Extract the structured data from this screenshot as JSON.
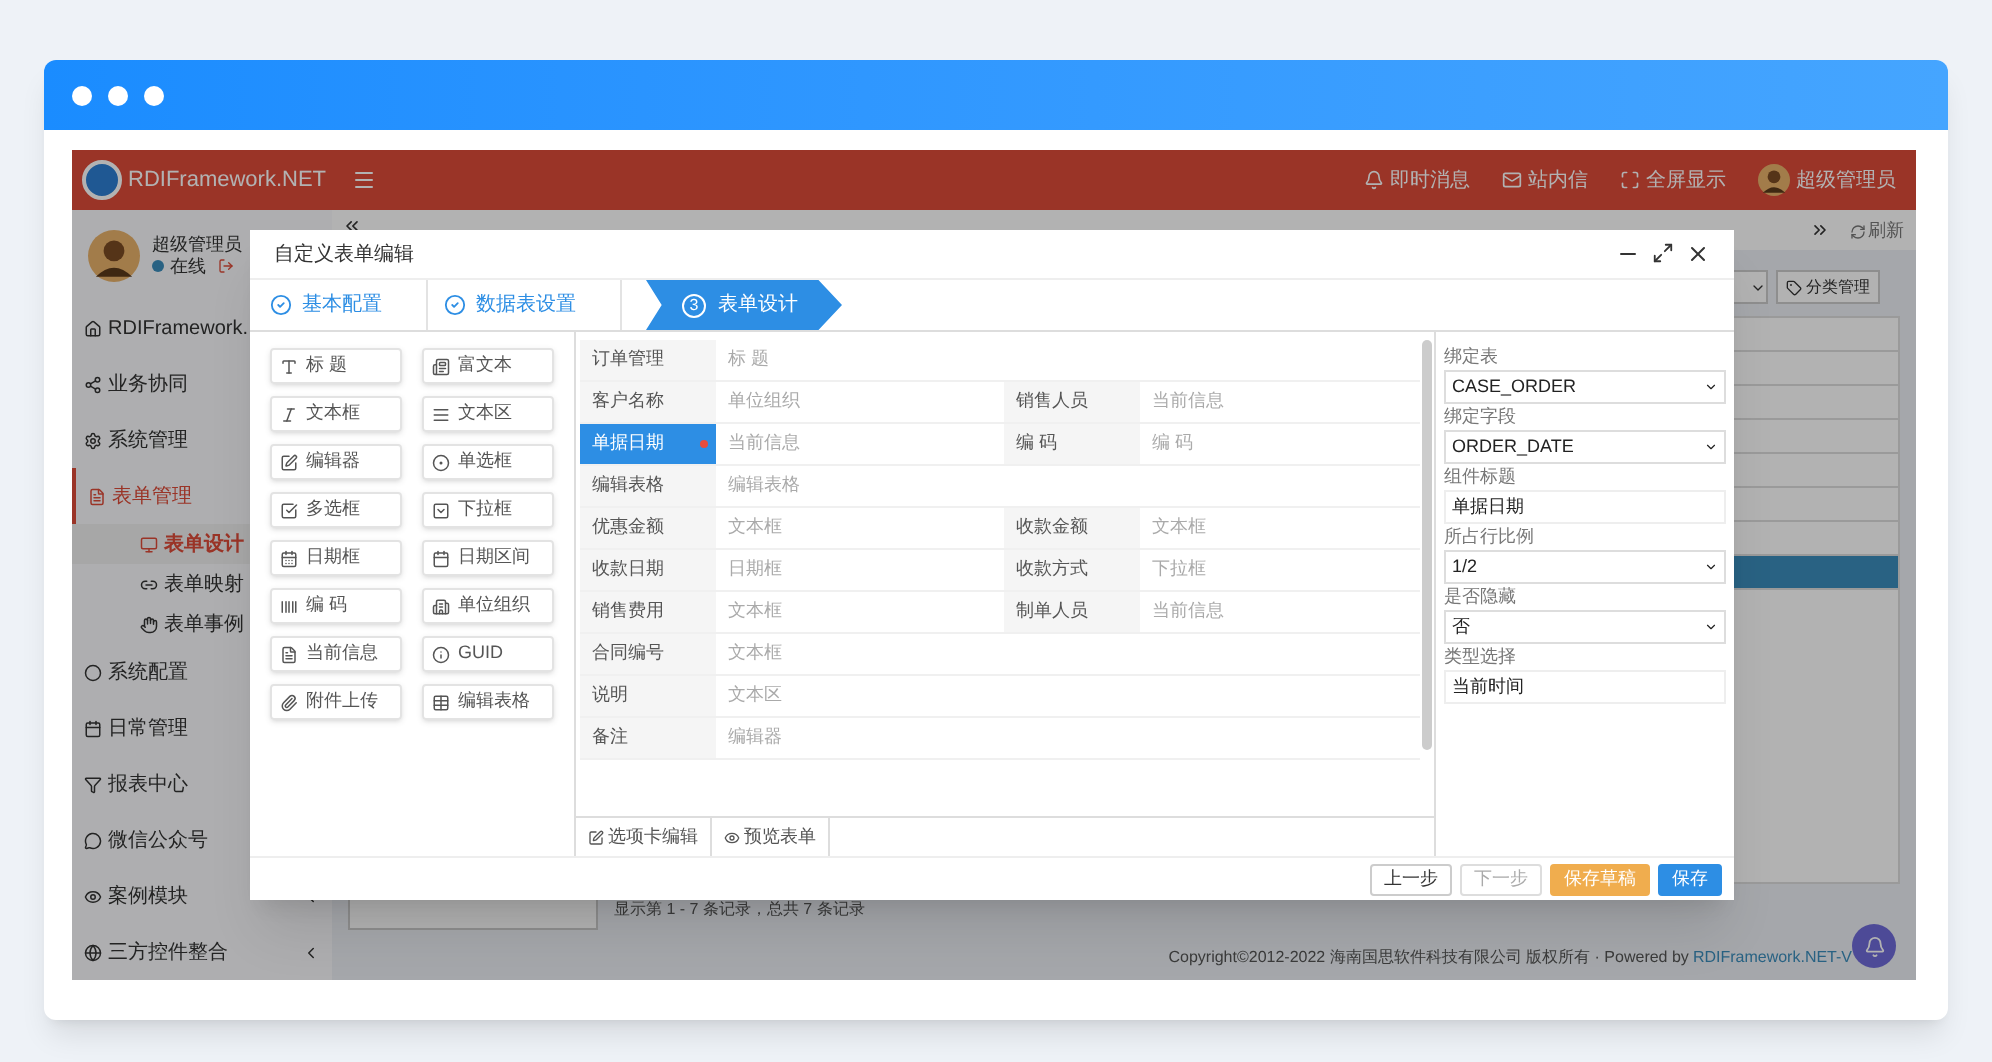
{
  "app": {
    "brand": "RDIFramework.NET",
    "top_links": [
      {
        "label": "即时消息"
      },
      {
        "label": "站内信"
      },
      {
        "label": "全屏显示"
      },
      {
        "label": "超级管理员"
      }
    ]
  },
  "user": {
    "name": "超级管理员",
    "status": "在线"
  },
  "sidebar": {
    "items": [
      {
        "label": "RDIFramework.",
        "expanded": false
      },
      {
        "label": "业务协同",
        "expanded": false
      },
      {
        "label": "系统管理",
        "expanded": false
      },
      {
        "label": "表单管理",
        "expanded": true,
        "children": [
          {
            "label": "表单设计",
            "selected": true
          },
          {
            "label": "表单映射",
            "selected": false
          },
          {
            "label": "表单事例",
            "selected": false
          }
        ]
      },
      {
        "label": "系统配置",
        "expanded": false
      },
      {
        "label": "日常管理",
        "expanded": false
      },
      {
        "label": "报表中心",
        "expanded": false
      },
      {
        "label": "微信公众号",
        "expanded": false
      },
      {
        "label": "案例模块",
        "expanded": false,
        "arrow": true
      },
      {
        "label": "三方控件整合",
        "expanded": false,
        "arrow": true
      }
    ]
  },
  "refresh": "刷新",
  "content": {
    "category_button": "分类管理",
    "table_rows": [
      {
        "selected": false
      },
      {
        "selected": false
      },
      {
        "selected": false
      },
      {
        "selected": false
      },
      {
        "selected": false
      },
      {
        "selected": false
      },
      {
        "selected": true
      }
    ],
    "pager_text": "显示第 1 - 7 条记录，总共 7 条记录"
  },
  "footer": {
    "copyright": "Copyright©2012-2022 海南国思软件科技有限公司 版权所有 · Powered by",
    "link": "RDIFramework.NET-V"
  },
  "dialog": {
    "title": "自定义表单编辑",
    "steps": [
      {
        "label": "基本配置",
        "selected": false
      },
      {
        "label": "数据表设置",
        "selected": false
      },
      {
        "label": "表单设计",
        "number": "3",
        "selected": true
      }
    ],
    "palette": [
      {
        "label": "标 题"
      },
      {
        "label": "富文本"
      },
      {
        "label": "文本框"
      },
      {
        "label": "文本区"
      },
      {
        "label": "编辑器"
      },
      {
        "label": "单选框"
      },
      {
        "label": "多选框"
      },
      {
        "label": "下拉框"
      },
      {
        "label": "日期框"
      },
      {
        "label": "日期区间"
      },
      {
        "label": "编 码"
      },
      {
        "label": "单位组织"
      },
      {
        "label": "当前信息"
      },
      {
        "label": "GUID"
      },
      {
        "label": "附件上传"
      },
      {
        "label": "编辑表格"
      }
    ],
    "form_rows": [
      {
        "fields": [
          {
            "label": "订单管理",
            "placeholder": "标 题",
            "selected": false
          }
        ]
      },
      {
        "fields": [
          {
            "label": "客户名称",
            "placeholder": "单位组织",
            "selected": false
          },
          {
            "label": "销售人员",
            "placeholder": "当前信息",
            "selected": false
          }
        ]
      },
      {
        "fields": [
          {
            "label": "单据日期",
            "placeholder": "当前信息",
            "selected": true
          },
          {
            "label": "编 码",
            "placeholder": "编 码",
            "selected": false
          }
        ]
      },
      {
        "fields": [
          {
            "label": "编辑表格",
            "placeholder": "编辑表格",
            "selected": false
          }
        ]
      },
      {
        "fields": [
          {
            "label": "优惠金额",
            "placeholder": "文本框",
            "selected": false
          },
          {
            "label": "收款金额",
            "placeholder": "文本框",
            "selected": false
          }
        ]
      },
      {
        "fields": [
          {
            "label": "收款日期",
            "placeholder": "日期框",
            "selected": false
          },
          {
            "label": "收款方式",
            "placeholder": "下拉框",
            "selected": false
          }
        ]
      },
      {
        "fields": [
          {
            "label": "销售费用",
            "placeholder": "文本框",
            "selected": false
          },
          {
            "label": "制单人员",
            "placeholder": "当前信息",
            "selected": false
          }
        ]
      },
      {
        "fields": [
          {
            "label": "合同编号",
            "placeholder": "文本框",
            "selected": false
          }
        ]
      },
      {
        "fields": [
          {
            "label": "说明",
            "placeholder": "文本区",
            "selected": false
          }
        ]
      },
      {
        "fields": [
          {
            "label": "备注",
            "placeholder": "编辑器",
            "selected": false
          }
        ]
      }
    ],
    "bottom_tabs": [
      {
        "label": "选项卡编辑",
        "selected": false
      },
      {
        "label": "预览表单",
        "selected": false
      }
    ],
    "properties": [
      {
        "label": "绑定表",
        "kind": "select",
        "value": "CASE_ORDER"
      },
      {
        "label": "绑定字段",
        "kind": "select",
        "value": "ORDER_DATE"
      },
      {
        "label": "组件标题",
        "kind": "input",
        "value": "单据日期"
      },
      {
        "label": "所占行比例",
        "kind": "select",
        "value": "1/2"
      },
      {
        "label": "是否隐藏",
        "kind": "select",
        "value": "否"
      },
      {
        "label": "类型选择",
        "kind": "input",
        "value": "当前时间"
      }
    ],
    "buttons": [
      {
        "label": "上一步",
        "kind": "default",
        "disabled": false
      },
      {
        "label": "下一步",
        "kind": "default",
        "disabled": true
      },
      {
        "label": "保存草稿",
        "kind": "warning",
        "disabled": false
      },
      {
        "label": "保存",
        "kind": "primary",
        "disabled": false
      }
    ]
  }
}
